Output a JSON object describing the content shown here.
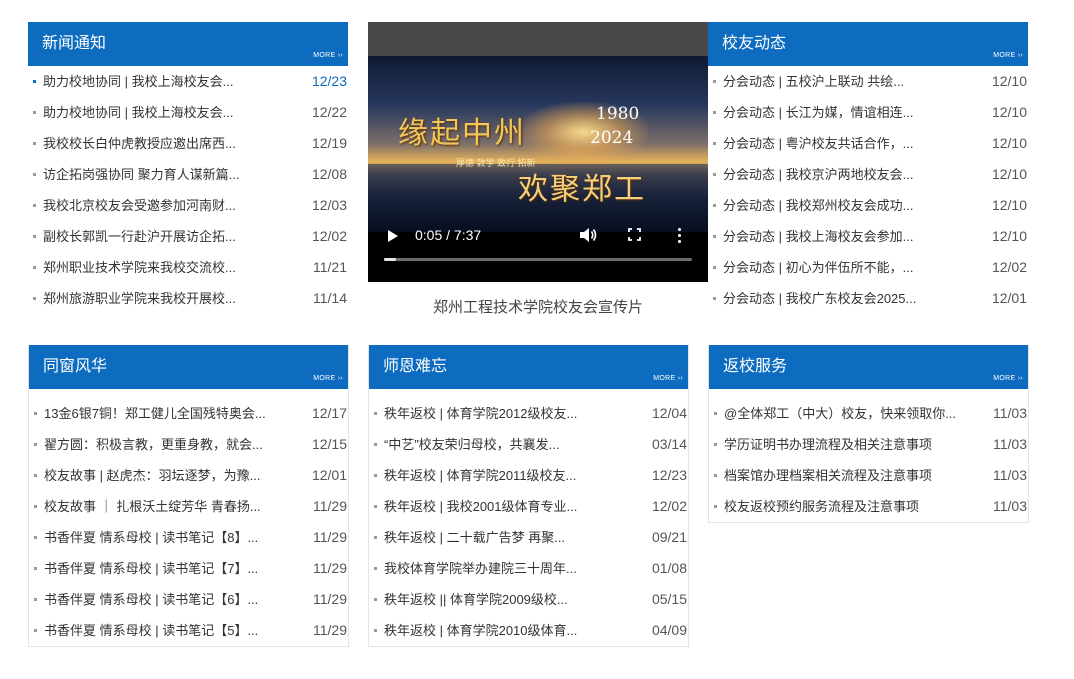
{
  "more_label": "MORE",
  "news": {
    "title": "新闻通知",
    "items": [
      {
        "title": "助力校地协同 | 我校上海校友会...",
        "date": "12/23"
      },
      {
        "title": "助力校地协同 | 我校上海校友会...",
        "date": "12/22"
      },
      {
        "title": "我校校长白仲虎教授应邀出席西...",
        "date": "12/19"
      },
      {
        "title": "访企拓岗强协同 聚力育人谋新篇...",
        "date": "12/08"
      },
      {
        "title": "我校北京校友会受邀参加河南财...",
        "date": "12/03"
      },
      {
        "title": "副校长郭凯一行赴沪开展访企拓...",
        "date": "12/02"
      },
      {
        "title": "郑州职业技术学院来我校交流校...",
        "date": "11/21"
      },
      {
        "title": "郑州旅游职业学院来我校开展校...",
        "date": "11/14"
      }
    ]
  },
  "video": {
    "title_line1": "缘起中州",
    "title_line2": "欢聚郑工",
    "year_start": "1980",
    "year_end": "2024",
    "motto": "厚德 敦学 致行 拓新",
    "time": "0:05 / 7:37",
    "progress": 0.011,
    "caption": "郑州工程技术学院校友会宣传片"
  },
  "alumni": {
    "title": "校友动态",
    "items": [
      {
        "title": "分会动态 | 五校沪上联动 共绘...",
        "date": "12/10"
      },
      {
        "title": "分会动态 | 长江为媒，情谊相连...",
        "date": "12/10"
      },
      {
        "title": "分会动态 | 粤沪校友共话合作，...",
        "date": "12/10"
      },
      {
        "title": "分会动态 | 我校京沪两地校友会...",
        "date": "12/10"
      },
      {
        "title": "分会动态 | 我校郑州校友会成功...",
        "date": "12/10"
      },
      {
        "title": "分会动态 | 我校上海校友会参加...",
        "date": "12/10"
      },
      {
        "title": "分会动态 | 初心为伴伍所不能，...",
        "date": "12/02"
      },
      {
        "title": "分会动态 | 我校广东校友会2025...",
        "date": "12/01"
      }
    ]
  },
  "classmates": {
    "title": "同窗风华",
    "items": [
      {
        "title": "13金6银7铜！郑工健儿全国残特奥会...",
        "date": "12/17"
      },
      {
        "title": "翟方圆：积极言教，更重身教，就会...",
        "date": "12/15"
      },
      {
        "title": "校友故事 | 赵虎杰：羽坛逐梦，为豫...",
        "date": "12/01"
      },
      {
        "title": "校友故事 ｜ 扎根沃土绽芳华 青春扬...",
        "date": "11/29"
      },
      {
        "title": "书香伴夏 情系母校 | 读书笔记【8】...",
        "date": "11/29"
      },
      {
        "title": "书香伴夏 情系母校 | 读书笔记【7】...",
        "date": "11/29"
      },
      {
        "title": "书香伴夏 情系母校 | 读书笔记【6】...",
        "date": "11/29"
      },
      {
        "title": "书香伴夏 情系母校 | 读书笔记【5】...",
        "date": "11/29"
      }
    ]
  },
  "teachers": {
    "title": "师恩难忘",
    "items": [
      {
        "title": "秩年返校 | 体育学院2012级校友...",
        "date": "12/04"
      },
      {
        "title": "“中艺”校友荣归母校，共襄发...",
        "date": "03/14"
      },
      {
        "title": "秩年返校 | 体育学院2011级校友...",
        "date": "12/23"
      },
      {
        "title": "秩年返校 |  我校2001级体育专业...",
        "date": "12/02"
      },
      {
        "title": "秩年返校 | 二十载广告梦 再聚...",
        "date": "09/21"
      },
      {
        "title": "我校体育学院举办建院三十周年...",
        "date": "01/08"
      },
      {
        "title": "秩年返校 || 体育学院2009级校...",
        "date": "05/15"
      },
      {
        "title": "秩年返校 | 体育学院2010级体育...",
        "date": "04/09"
      }
    ]
  },
  "service": {
    "title": "返校服务",
    "items": [
      {
        "title": "@全体郑工（中大）校友，快来领取你...",
        "date": "11/03"
      },
      {
        "title": "学历证明书办理流程及相关注意事项",
        "date": "11/03"
      },
      {
        "title": "档案馆办理档案相关流程及注意事项",
        "date": "11/03"
      },
      {
        "title": "校友返校预约服务流程及注意事项",
        "date": "11/03"
      }
    ]
  },
  "colors": {
    "header_blue": "#0d6cbf",
    "active_date": "#0d6cbf"
  }
}
